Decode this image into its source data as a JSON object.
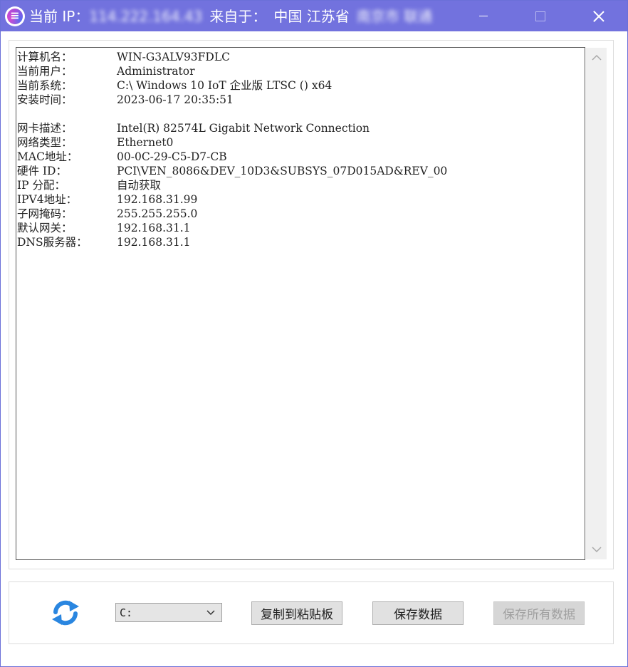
{
  "titlebar": {
    "ip_label": "当前 IP：",
    "ip_value": "114.222.164.43",
    "from_label": "来自于：",
    "location": "中国 江苏省",
    "location_detail": "南京市 联通",
    "accent": "#7272de"
  },
  "window_controls": {
    "minimize": "minimize-icon",
    "maximize": "maximize-icon",
    "close": "close-icon"
  },
  "info": {
    "rows": [
      {
        "key": "计算机名：",
        "value": "WIN-G3ALV93FDLC"
      },
      {
        "key": "当前用户：",
        "value": "Administrator"
      },
      {
        "key": "当前系统：",
        "value": "C:\\ Windows 10 IoT 企业版 LTSC () x64"
      },
      {
        "key": "安装时间：",
        "value": "2023-06-17 20:35:51"
      },
      {
        "key": "",
        "value": ""
      },
      {
        "key": "网卡描述：",
        "value": "Intel(R) 82574L Gigabit Network Connection"
      },
      {
        "key": "网络类型：",
        "value": "Ethernet0"
      },
      {
        "key": "MAC地址：",
        "value": "00-0C-29-C5-D7-CB"
      },
      {
        "key": "硬件 ID：",
        "value": "PCI\\VEN_8086&DEV_10D3&SUBSYS_07D015AD&REV_00"
      },
      {
        "key": "IP 分配：",
        "value": "自动获取"
      },
      {
        "key": "IPV4地址：",
        "value": "192.168.31.99"
      },
      {
        "key": "子网掩码：",
        "value": "255.255.255.0"
      },
      {
        "key": "默认网关：",
        "value": "192.168.31.1"
      },
      {
        "key": "DNS服务器：",
        "value": "192.168.31.1"
      }
    ]
  },
  "bottom": {
    "refresh_icon": "refresh-icon",
    "drive_selected": "C:",
    "copy_label": "复制到粘贴板",
    "save_label": "保存数据",
    "save_all_label": "保存所有数据"
  }
}
